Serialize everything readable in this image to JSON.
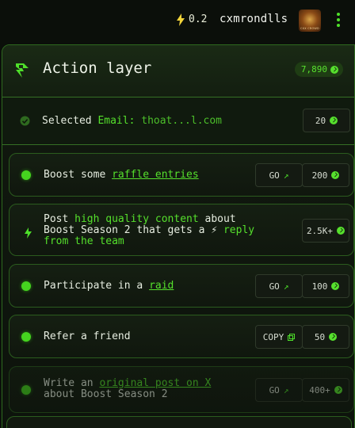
{
  "topbar": {
    "balance": "0.2",
    "username": "cxmrondlls",
    "avatar_text": "CXX CROWD"
  },
  "header": {
    "title": "Action layer",
    "points": "7,890"
  },
  "email": {
    "prefix": "Selected",
    "label": "Email:",
    "value": "thoat...l.com",
    "reward": "20"
  },
  "tasks": [
    {
      "pre": "Boost some ",
      "link": "raffle entries",
      "post": "",
      "action": "GO",
      "reward": "200"
    },
    {
      "l1a": "Post ",
      "l1b": "high quality content",
      "l1c": " about",
      "l2a": "Boost Season 2 that gets a ",
      "l2b": "reply",
      "l3": "from the team",
      "reward": "2.5K+"
    },
    {
      "pre": "Participate in a ",
      "link": "raid",
      "post": "",
      "action": "GO",
      "reward": "100"
    },
    {
      "pre": "Refer a friend",
      "link": "",
      "post": "",
      "action": "COPY",
      "reward": "50"
    },
    {
      "l1a": "Write an ",
      "l1b": "original post on X",
      "l2": "about Boost Season 2",
      "action": "GO",
      "reward": "400+"
    }
  ],
  "colors": {
    "accent": "#55e02c",
    "background": "#0b0f0a",
    "border": "#2b5c1e"
  }
}
